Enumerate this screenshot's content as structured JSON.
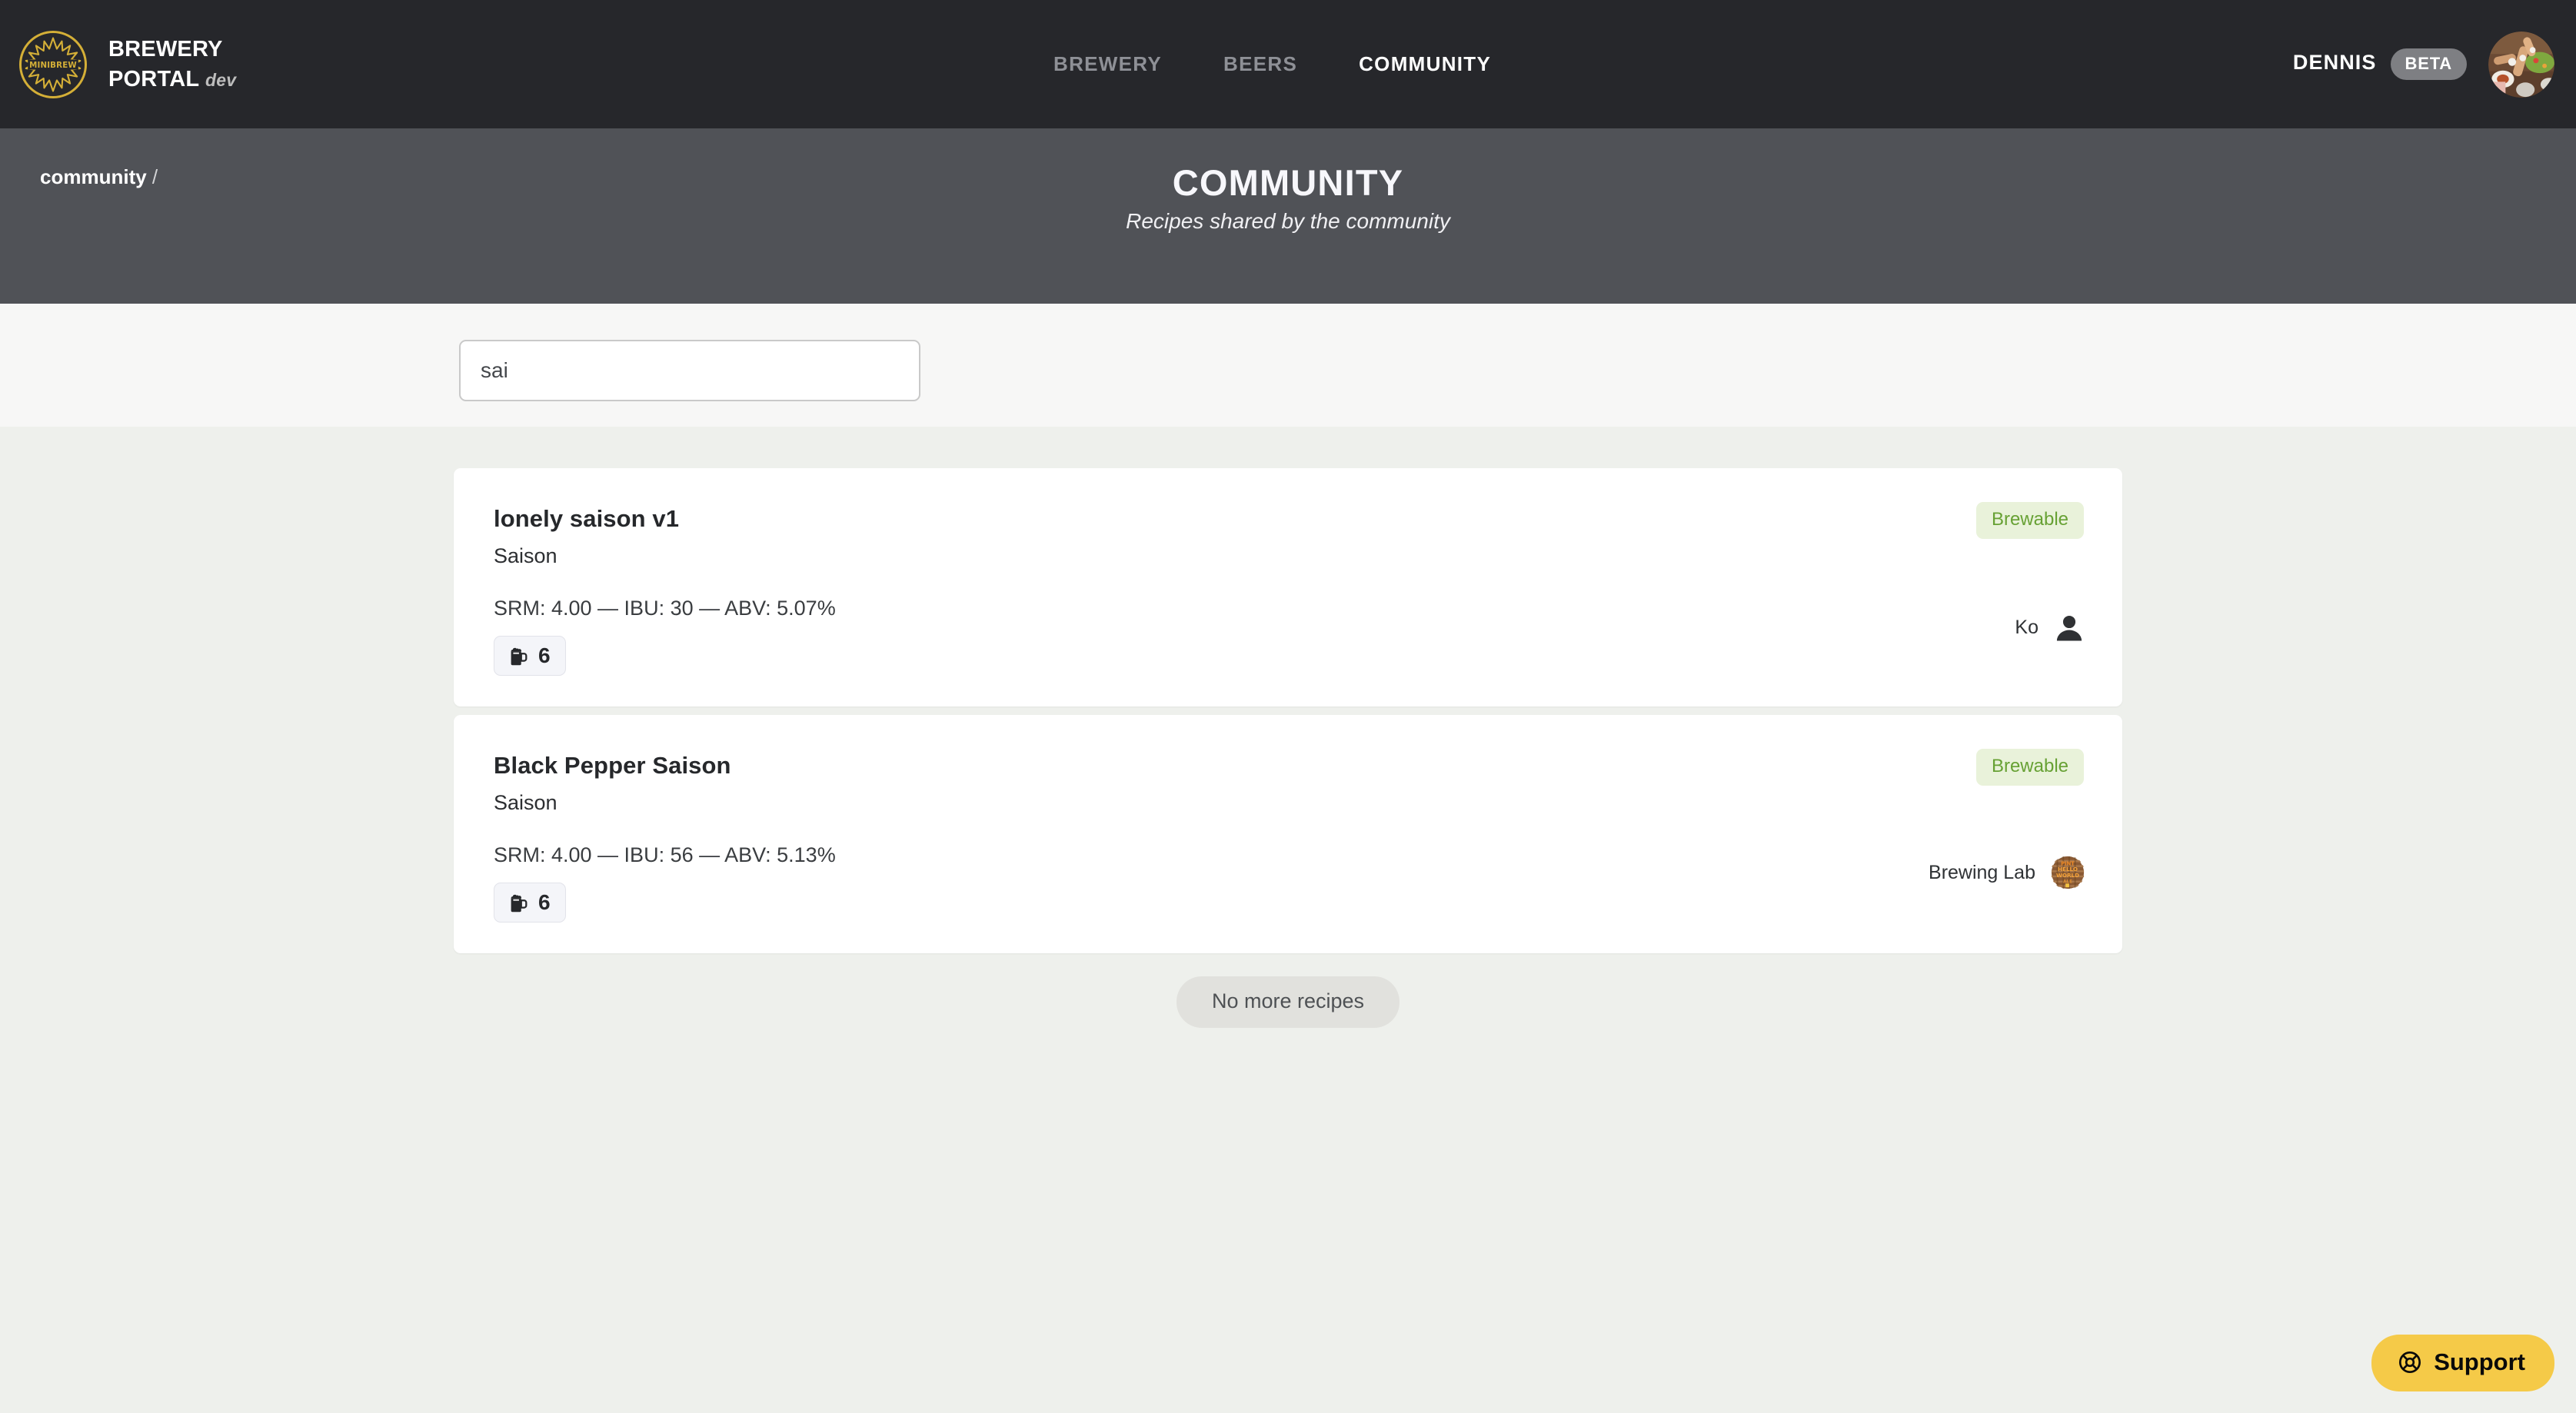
{
  "topbar": {
    "logo_icon": "minibrew-starburst-logo",
    "brand_line1": "BREWERY",
    "brand_line2": "PORTAL",
    "brand_env": "dev",
    "nav": [
      {
        "label": "BREWERY",
        "active": false
      },
      {
        "label": "BEERS",
        "active": false
      },
      {
        "label": "COMMUNITY",
        "active": true
      }
    ],
    "user": {
      "name": "DENNIS",
      "badge": "BETA",
      "avatar_icon": "user-avatar-photo"
    },
    "colors": {
      "background": "#26272b",
      "brand_gold": "#d4af37",
      "beta_pill": "#7e7f83"
    }
  },
  "header": {
    "breadcrumb": "community",
    "breadcrumb_separator": "/",
    "title": "COMMUNITY",
    "subtitle": "Recipes shared by the community",
    "background": "#505257"
  },
  "search": {
    "value": "sai",
    "placeholder": "",
    "band_background": "#f7f7f6"
  },
  "main": {
    "background": "#eef0ec",
    "recipes": [
      {
        "name": "lonely saison v1",
        "style": "Saison",
        "stats": "SRM: 4.00 — IBU: 30 — ABV: 5.07%",
        "srm": "4.00",
        "ibu": "30",
        "abv": "5.07%",
        "servings": "6",
        "servings_icon": "beer-mug-icon",
        "status_badge": "Brewable",
        "author": "Ko",
        "author_avatar_icon": "person-silhouette-icon"
      },
      {
        "name": "Black Pepper Saison",
        "style": "Saison",
        "stats": "SRM: 4.00 — IBU: 56 — ABV: 5.13%",
        "srm": "4.00",
        "ibu": "56",
        "abv": "5.13%",
        "servings": "6",
        "servings_icon": "beer-mug-icon",
        "status_badge": "Brewable",
        "author": "Brewing Lab",
        "author_avatar_icon": "hello-world-globe-logo"
      }
    ],
    "end_of_list": "No more recipes",
    "badge_colors": {
      "brewable_text": "#67a134",
      "brewable_bg": "#e9f2da"
    }
  },
  "support": {
    "label": "Support",
    "icon": "lifebuoy-icon",
    "color": "#f5ca48"
  }
}
